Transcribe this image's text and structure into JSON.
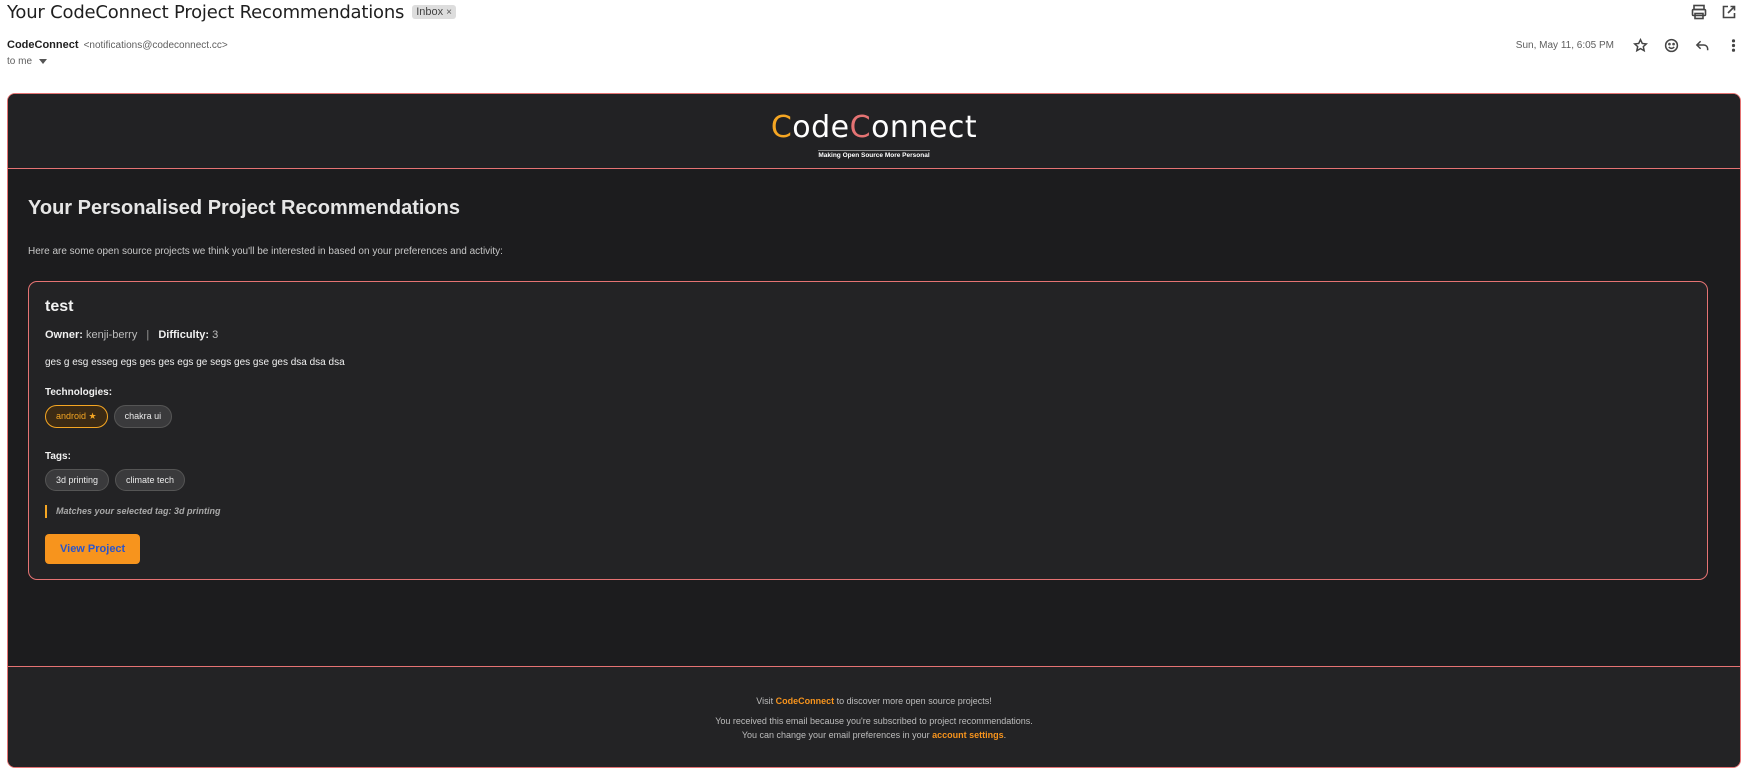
{
  "mail": {
    "subject": "Your CodeConnect Project Recommendations",
    "label_chip": "Inbox",
    "label_close": "×",
    "sender_name": "CodeConnect",
    "sender_email": "<notifications@codeconnect.cc>",
    "recipient": "to me",
    "date": "Sun, May 11, 6:05 PM",
    "icons": [
      "print-icon",
      "open-in-new-window-icon",
      "star-icon",
      "emoji-icon",
      "reply-icon",
      "more-vert-icon"
    ]
  },
  "email": {
    "logo": {
      "part_c1": "C",
      "part_ode": "ode",
      "part_c2": "C",
      "part_onnect": "onnect",
      "tagline": "Making Open Source More Personal"
    },
    "heading": "Your Personalised Project Recommendations",
    "intro": "Here are some open source projects we think you'll be interested in based on your preferences and activity:",
    "project": {
      "name": "test",
      "owner_label": "Owner:",
      "owner": "kenji-berry",
      "separator": "|",
      "difficulty_label": "Difficulty:",
      "difficulty": "3",
      "description": "ges g esg esseg egs ges ges egs ge segs ges gse ges dsa dsa dsa",
      "technologies_label": "Technologies:",
      "technologies": [
        "android ★",
        "chakra ui"
      ],
      "tags_label": "Tags:",
      "tags": [
        "3d printing",
        "climate tech"
      ],
      "match_note": "Matches your selected tag: 3d printing",
      "button": "View Project"
    },
    "footer": {
      "visit_prefix": "Visit",
      "visit_link": "CodeConnect",
      "visit_suffix": "to discover more open source projects!",
      "reason": "You received this email because you're subscribed to project recommendations.",
      "prefs_prefix": "You can change your email preferences in your",
      "prefs_link": "account settings",
      "prefs_suffix": "."
    }
  },
  "colors": {
    "accent_orange": "#f7941d",
    "accent_red": "#e57373",
    "logo_yellow": "#f5a623",
    "email_bg": "#1c1c1e"
  }
}
